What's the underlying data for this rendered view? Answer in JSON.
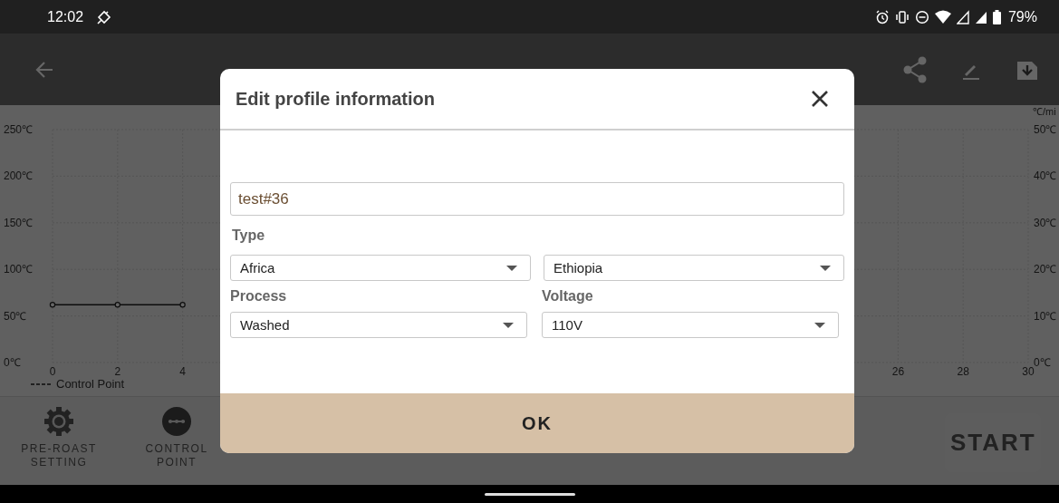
{
  "status_bar": {
    "time": "12:02",
    "battery": "79%"
  },
  "chart": {
    "chart_data": {
      "type": "line",
      "x": [
        0,
        2,
        4
      ],
      "series": [
        {
          "name": "Control Point",
          "color": "#222222",
          "values": [
            62,
            62,
            62
          ],
          "marker": "circle"
        }
      ],
      "grid": true,
      "xlim": [
        0,
        30
      ],
      "ylim": [
        0,
        250
      ],
      "xticks": [
        0,
        2,
        4,
        26,
        28,
        30
      ],
      "yticks": [
        {
          "value": 0,
          "label": "0℃"
        },
        {
          "value": 50,
          "label": "50℃"
        },
        {
          "value": 100,
          "label": "100℃"
        },
        {
          "value": 150,
          "label": "150℃"
        },
        {
          "value": 200,
          "label": "200℃"
        },
        {
          "value": 250,
          "label": "250℃"
        }
      ]
    },
    "right_axis_unit": "℃/mi",
    "right_axis_labels": [
      "50℃",
      "40℃",
      "30℃",
      "20℃",
      "10℃",
      "0℃"
    ]
  },
  "bottom_bar": {
    "actions": [
      {
        "kind": "gear",
        "label": "PRE-ROAST SETTING"
      },
      {
        "kind": "control",
        "label": "CONTROL POINT"
      }
    ],
    "start": {
      "label": "START",
      "disabled": true
    }
  },
  "dialog": {
    "title": "Edit profile information",
    "name_value": "test#36",
    "type_label": "Type",
    "type_selects": [
      "Africa",
      "Ethiopia"
    ],
    "columns": [
      {
        "label": "Process",
        "value": "Washed"
      },
      {
        "label": "Voltage",
        "value": "110V"
      }
    ],
    "ok": "OK"
  }
}
